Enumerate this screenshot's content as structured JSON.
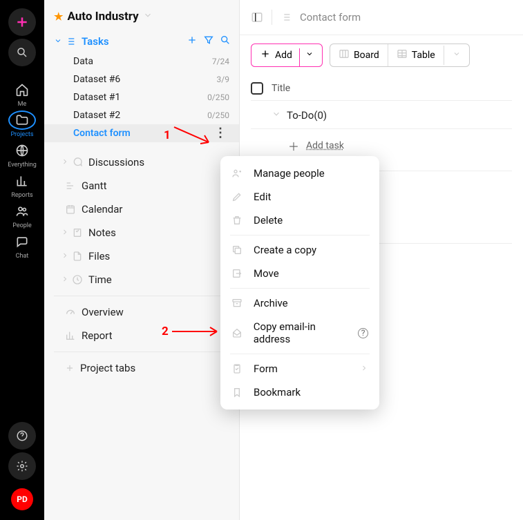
{
  "rail": {
    "me": "Me",
    "projects": "Projects",
    "everything": "Everything",
    "reports": "Reports",
    "people": "People",
    "chat": "Chat",
    "avatar": "PD"
  },
  "project": {
    "title": "Auto Industry",
    "tasks_label": "Tasks",
    "items": [
      {
        "label": "Data",
        "meta": "7/24"
      },
      {
        "label": "Dataset #6",
        "meta": "3/9"
      },
      {
        "label": "Dataset #1",
        "meta": "0/250"
      },
      {
        "label": "Dataset #2",
        "meta": "0/250"
      },
      {
        "label": "Contact form",
        "meta": ""
      }
    ],
    "nav": {
      "discussions": "Discussions",
      "gantt": "Gantt",
      "calendar": "Calendar",
      "notes": "Notes",
      "files": "Files",
      "time": "Time",
      "overview": "Overview",
      "report": "Report",
      "project_tabs": "Project tabs"
    }
  },
  "main": {
    "crumb": "Contact form",
    "add_btn": "Add",
    "board_btn": "Board",
    "table_btn": "Table",
    "title_col": "Title",
    "group": "To-Do(0)",
    "add_task": "Add task"
  },
  "menu": {
    "manage_people": "Manage people",
    "edit": "Edit",
    "delete": "Delete",
    "create_copy": "Create a copy",
    "move": "Move",
    "archive": "Archive",
    "copy_email": "Copy email-in address",
    "form": "Form",
    "bookmark": "Bookmark"
  },
  "annotations": {
    "a1": "1",
    "a2": "2"
  }
}
